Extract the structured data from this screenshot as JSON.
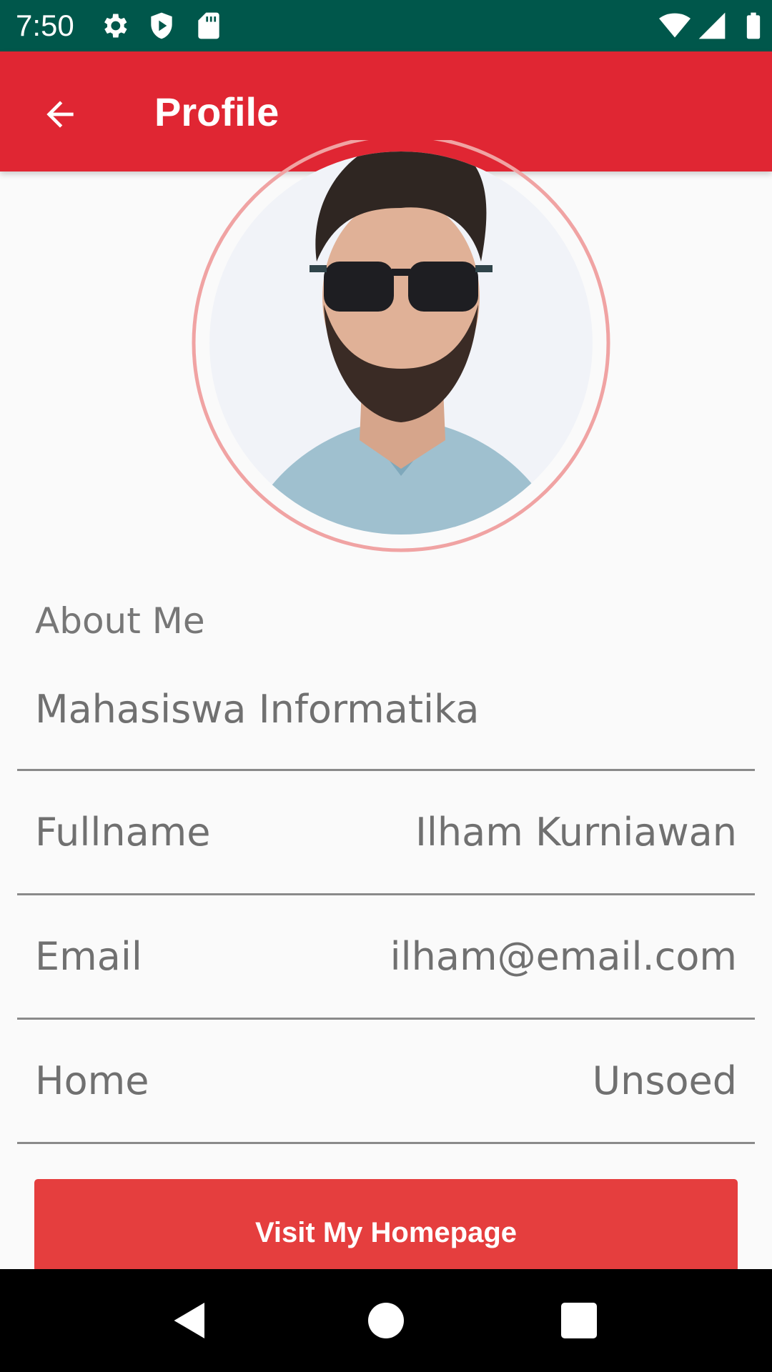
{
  "status_bar": {
    "time": "7:50",
    "icons": [
      "gear-icon",
      "play-protect-icon",
      "sd-card-icon",
      "wifi-icon",
      "signal-icon",
      "battery-icon"
    ]
  },
  "app_bar": {
    "title": "Profile",
    "back_icon": "arrow-back-icon",
    "color": "#e02633"
  },
  "profile": {
    "about_label": "About Me",
    "about_value": "Mahasiswa Informatika",
    "rows": [
      {
        "label": "Fullname",
        "value": "Ilham Kurniawan"
      },
      {
        "label": "Email",
        "value": "ilham@email.com"
      },
      {
        "label": "Home",
        "value": "Unsoed"
      }
    ]
  },
  "button": {
    "label": "Visit My Homepage",
    "color": "#e53e3e"
  },
  "nav_bar": {
    "icons": [
      "back-triangle-icon",
      "home-circle-icon",
      "recents-square-icon"
    ]
  }
}
